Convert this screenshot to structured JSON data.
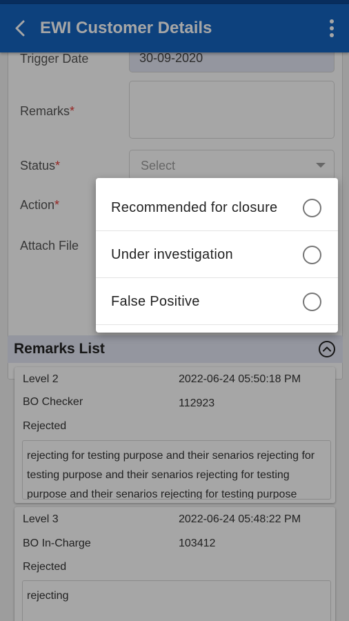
{
  "app_bar": {
    "title": "EWI Customer Details",
    "back_icon": "chevron-left-icon",
    "menu_icon": "more-vertical-icon"
  },
  "form": {
    "trigger_date_label": "Trigger Date",
    "trigger_date_value": "30-09-2020",
    "remarks_label": "Remarks",
    "status_label": "Status",
    "status_placeholder": "Select",
    "action_label": "Action",
    "attach_file_label": "Attach File",
    "required_mark": "*"
  },
  "remarks_list": {
    "title": "Remarks List",
    "items": [
      {
        "level": "Level 2",
        "timestamp": "2022-06-24 05:50:18 PM",
        "role": "BO Checker",
        "user_id": "112923",
        "status": "Rejected",
        "comment": "rejecting for testing purpose and their senarios rejecting for testing purpose and their senarios rejecting for testing purpose and their senarios rejecting for testing purpose"
      },
      {
        "level": "Level 3",
        "timestamp": "2022-06-24 05:48:22 PM",
        "role": "BO In-Charge",
        "user_id": "103412",
        "status": "Rejected",
        "comment": "rejecting"
      }
    ]
  },
  "action_popup": {
    "options": [
      {
        "label": "Recommended for closure"
      },
      {
        "label": "Under investigation"
      },
      {
        "label": "False Positive"
      }
    ]
  },
  "colors": {
    "app_bar": "#1565c0",
    "status_bar": "#0d4690",
    "required": "#e53935",
    "header_bg": "#e3e6f4"
  }
}
